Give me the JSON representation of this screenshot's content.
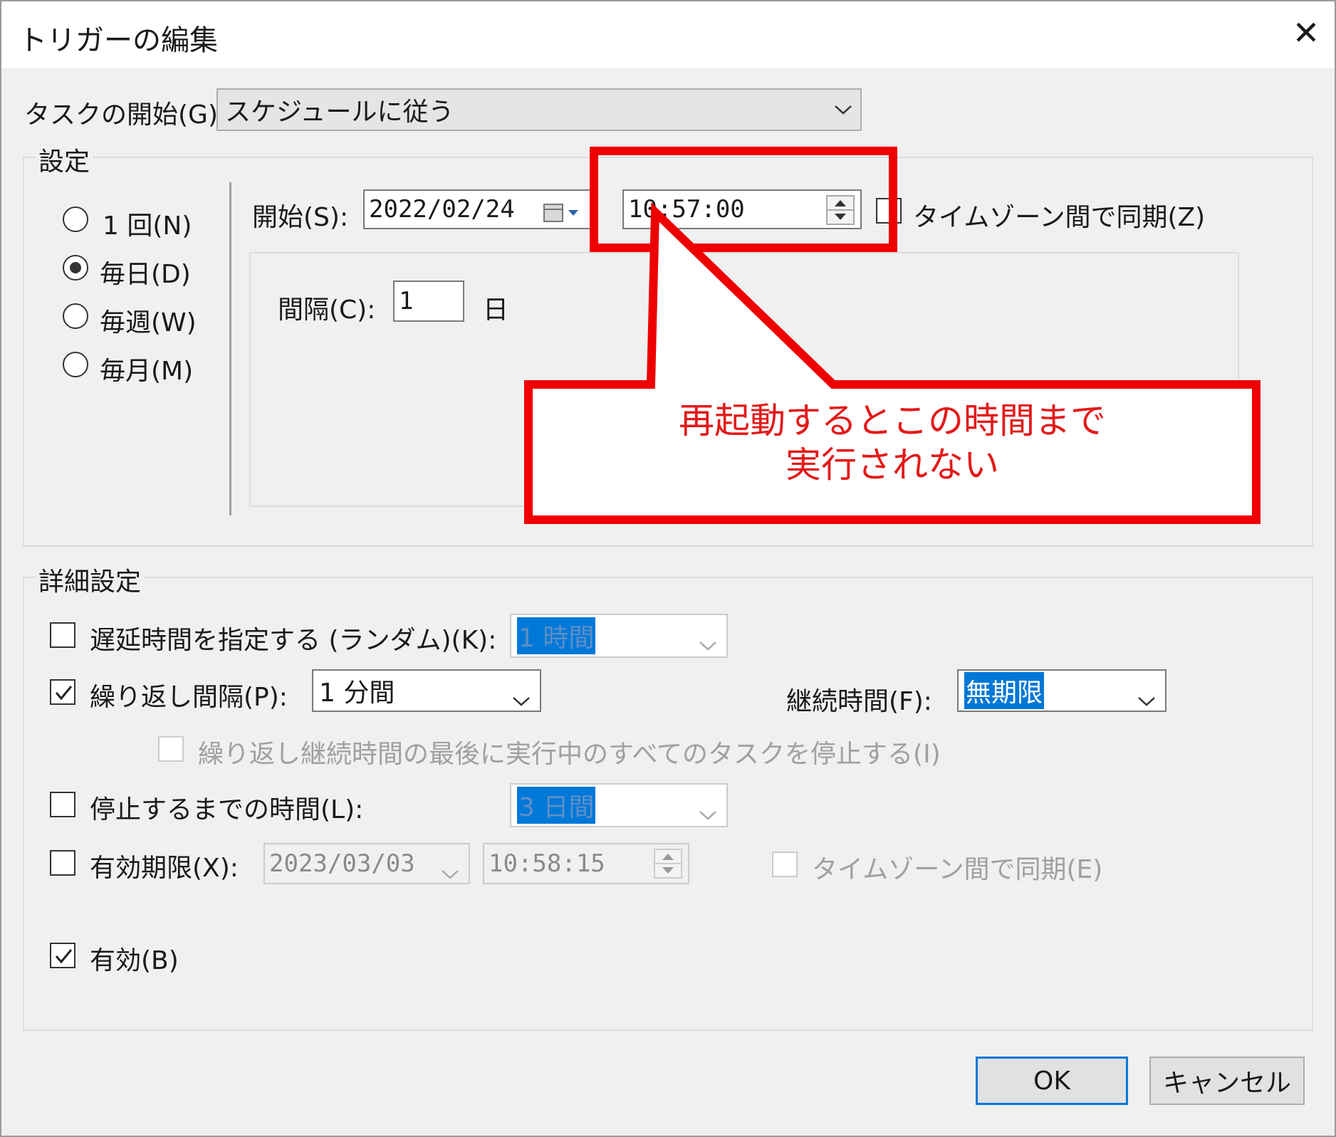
{
  "window": {
    "title": "トリガーの編集",
    "close_glyph": "✕"
  },
  "task_start": {
    "label": "タスクの開始(G):",
    "value": "スケジュールに従う"
  },
  "settings": {
    "legend": "設定",
    "radios": [
      {
        "label": "1 回(N)",
        "selected": false
      },
      {
        "label": "毎日(D)",
        "selected": true
      },
      {
        "label": "毎週(W)",
        "selected": false
      },
      {
        "label": "毎月(M)",
        "selected": false
      }
    ],
    "start_label": "開始(S):",
    "start_date": "2022/02/24",
    "start_time": "10:57:00",
    "sync_tz_label": "タイムゾーン間で同期(Z)",
    "interval_label": "間隔(C):",
    "interval_value": "1",
    "interval_unit": "日"
  },
  "advanced": {
    "legend": "詳細設定",
    "delay": {
      "label": "遅延時間を指定する (ランダム)(K):",
      "value": "1 時間",
      "checked": false
    },
    "repeat": {
      "label": "繰り返し間隔(P):",
      "value": "1 分間",
      "checked": true
    },
    "duration": {
      "label": "継続時間(F):",
      "value": "無期限"
    },
    "stop_all": {
      "label": "繰り返し継続時間の最後に実行中のすべてのタスクを停止する(I)",
      "checked": false
    },
    "stop_after": {
      "label": "停止するまでの時間(L):",
      "value": "3 日間",
      "checked": false
    },
    "expire": {
      "label": "有効期限(X):",
      "date": "2023/03/03",
      "time": "10:58:15",
      "checked": false,
      "sync_label": "タイムゾーン間で同期(E)"
    },
    "enabled": {
      "label": "有効(B)",
      "checked": true
    }
  },
  "buttons": {
    "ok": "OK",
    "cancel": "キャンセル"
  },
  "annotation": {
    "line1": "再起動するとこの時間まで",
    "line2": "実行されない",
    "color": "#ee0000"
  }
}
